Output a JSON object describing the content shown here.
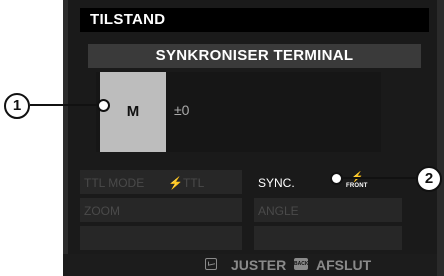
{
  "title": "TILSTAND",
  "subtitle": "SYNKRONISER TERMINAL",
  "mode": {
    "label": "M",
    "value": "±0"
  },
  "settings": {
    "ttl_label": "TTL MODE",
    "ttl_value": "⚡TTL",
    "zoom_label": "ZOOM",
    "sync_label": "SYNC.",
    "sync_value": "FRONT",
    "angle_label": "ANGLE"
  },
  "footer": {
    "adjust": "JUSTER",
    "back_badge": "BACK",
    "exit": "AFSLUT"
  },
  "callouts": [
    "1",
    "2"
  ]
}
